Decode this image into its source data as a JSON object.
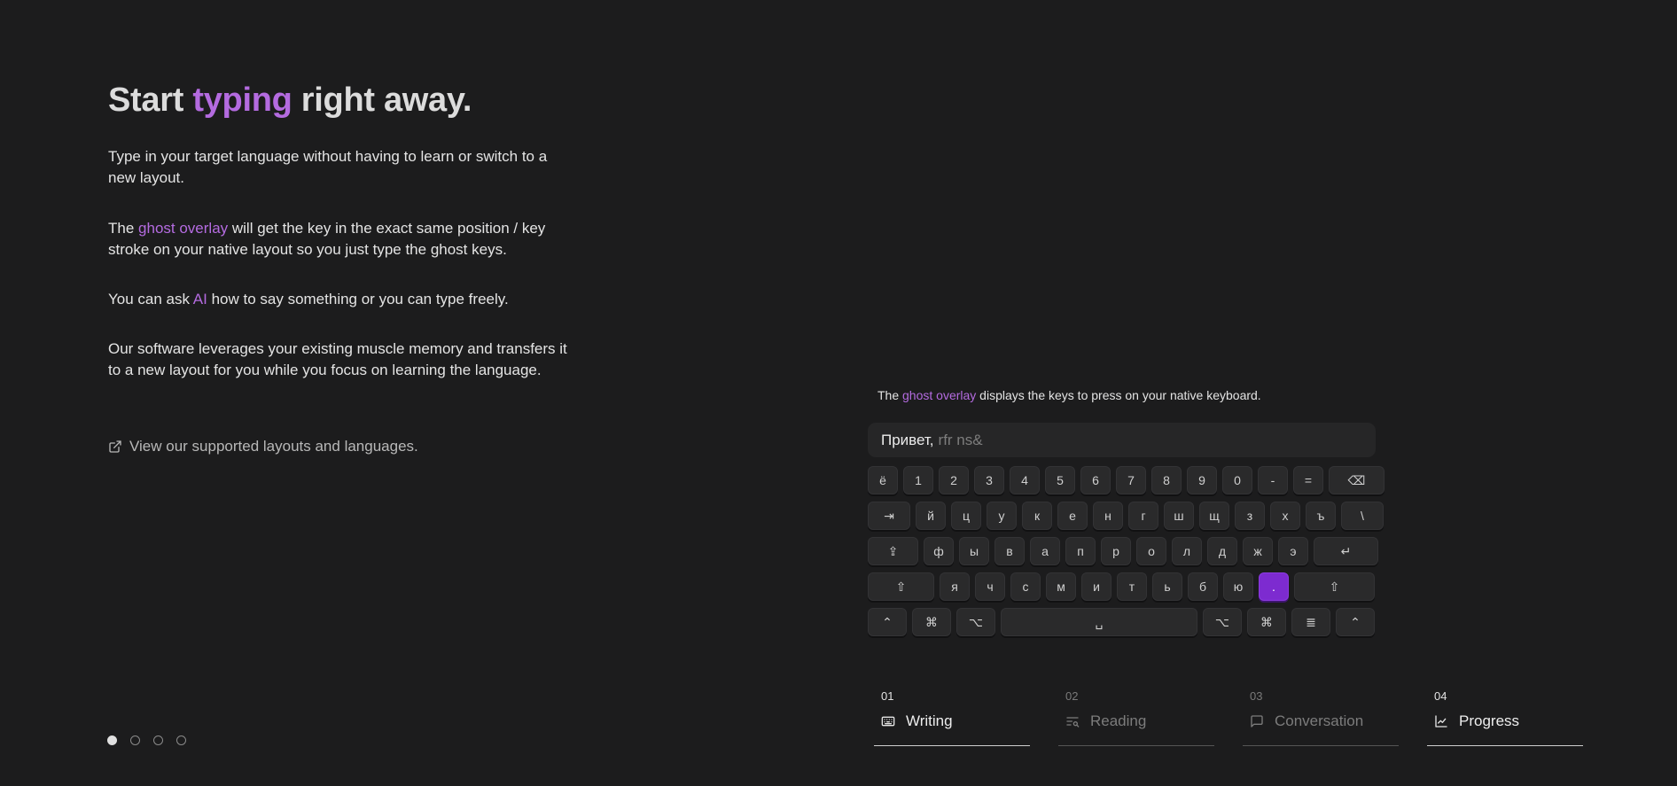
{
  "headline": {
    "prefix": "Start ",
    "accent": "typing",
    "suffix": " right away."
  },
  "paragraphs": {
    "p1": "Type in your target language without having to learn or switch to a new layout.",
    "p2_pre": "The ",
    "p2_accent": "ghost overlay",
    "p2_post": " will get the key in the exact same position / key stroke on your native layout so you just type the ghost keys.",
    "p3_pre": "You can ask ",
    "p3_accent": "AI",
    "p3_post": " how to say something or you can type freely.",
    "p4": "Our software leverages your existing muscle memory and transfers it to a new layout for you while you focus on learning the language."
  },
  "link": {
    "label": "View our supported layouts and languages.",
    "icon": "external-link-icon"
  },
  "pagination": {
    "count": 4,
    "active_index": 0
  },
  "demo": {
    "caption_pre": "The ",
    "caption_accent": "ghost overlay",
    "caption_post": " displays the keys to press on your native keyboard.",
    "typed": "Привет,",
    "ghost": "rfr ns&"
  },
  "keyboard": {
    "rows": [
      [
        "ё",
        "1",
        "2",
        "3",
        "4",
        "5",
        "6",
        "7",
        "8",
        "9",
        "0",
        "-",
        "=",
        "⌫"
      ],
      [
        "⇥",
        "й",
        "ц",
        "у",
        "к",
        "е",
        "н",
        "г",
        "ш",
        "щ",
        "з",
        "х",
        "ъ",
        "\\"
      ],
      [
        "⇪",
        "ф",
        "ы",
        "в",
        "а",
        "п",
        "р",
        "о",
        "л",
        "д",
        "ж",
        "э",
        "↵"
      ],
      [
        "⇧",
        "я",
        "ч",
        "с",
        "м",
        "и",
        "т",
        "ь",
        "б",
        "ю",
        ".",
        "⇧"
      ],
      [
        "⌃",
        "⌘",
        "⌥",
        "␣",
        "⌥",
        "⌘",
        "≣",
        "⌃"
      ]
    ],
    "highlighted": ".",
    "highlight_color": "#7d2bd0"
  },
  "tabs": [
    {
      "num": "01",
      "label": "Writing",
      "icon": "keyboard-icon"
    },
    {
      "num": "02",
      "label": "Reading",
      "icon": "text-search-icon"
    },
    {
      "num": "03",
      "label": "Conversation",
      "icon": "chat-bubble-icon"
    },
    {
      "num": "04",
      "label": "Progress",
      "icon": "chart-icon"
    }
  ],
  "colors": {
    "background": "#1c1c1d",
    "accent": "#b46be0",
    "key": "#2a2a2b"
  }
}
